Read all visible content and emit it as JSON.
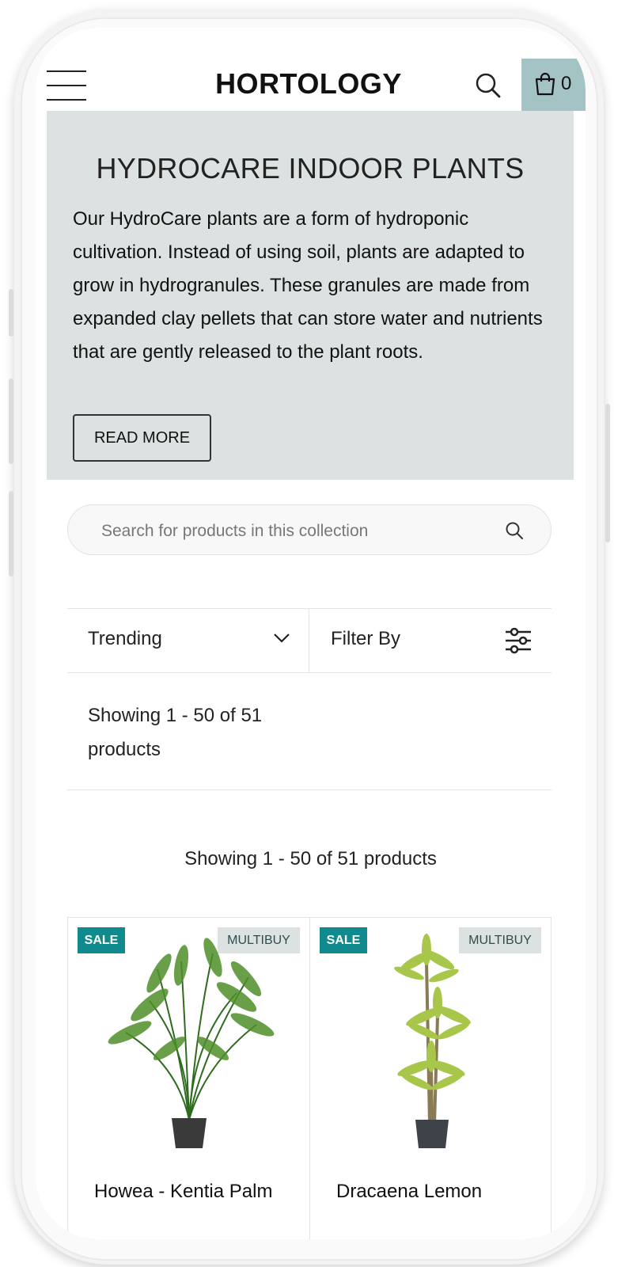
{
  "header": {
    "logo": "HORTOLOGY",
    "cart_count": "0"
  },
  "hero": {
    "title": "HYDROCARE INDOOR PLANTS",
    "description": "Our HydroCare plants are a form of hydroponic cultivation. Instead of using soil, plants are adapted to grow in hydrogranules. These granules are made from expanded clay pellets that can store water and nutrients that are gently released to the plant roots.",
    "button_label": "READ MORE"
  },
  "collection_search": {
    "placeholder": "Search for products in this collection"
  },
  "toolbar": {
    "sort_label": "Trending",
    "filter_label": "Filter By"
  },
  "results": {
    "showing_text": "Showing 1 - 50 of 51 products"
  },
  "products": [
    {
      "name": "Howea - Kentia Palm",
      "badge_sale": "SALE",
      "badge_multibuy": "MULTIBUY"
    },
    {
      "name": "Dracaena Lemon",
      "badge_sale": "SALE",
      "badge_multibuy": "MULTIBUY"
    }
  ],
  "colors": {
    "cart_bg": "#a4c3c4",
    "hero_bg": "#dce2e1",
    "sale_badge": "#108a8c",
    "multibuy_badge": "#dce2e1"
  }
}
